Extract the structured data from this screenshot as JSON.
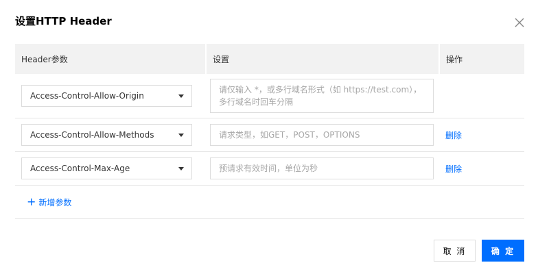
{
  "dialog": {
    "title": "设置HTTP Header"
  },
  "table": {
    "headers": [
      "Header参数",
      "设置",
      "操作"
    ],
    "rows": [
      {
        "param": "Access-Control-Allow-Origin",
        "placeholder": "请仅输入 *，或多行域名形式（如 https://test.com），多行域名时回车分隔",
        "action": ""
      },
      {
        "param": "Access-Control-Allow-Methods",
        "placeholder": "请求类型，如GET，POST，OPTIONS",
        "action": "删除"
      },
      {
        "param": "Access-Control-Max-Age",
        "placeholder": "预请求有效时间，单位为秒",
        "action": "删除"
      }
    ],
    "add_label": "新增参数"
  },
  "footer": {
    "cancel_label": "取 消",
    "ok_label": "确 定"
  },
  "colors": {
    "accent": "#006eff",
    "header_bg": "#f2f2f2",
    "border": "#dcdcdc",
    "placeholder": "#a7a7a7"
  },
  "icons": [
    "close-icon",
    "caret-down-icon",
    "plus-icon"
  ]
}
